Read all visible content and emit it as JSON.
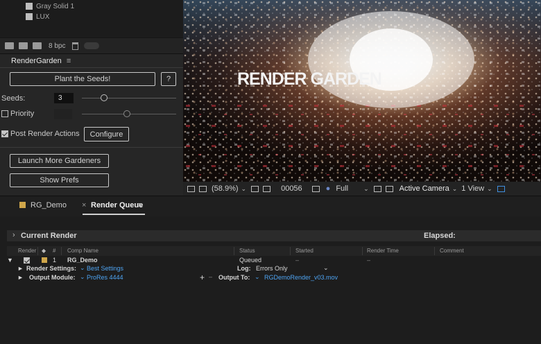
{
  "project": {
    "items": [
      "Gray Solid 1",
      "LUX"
    ],
    "bpc": "8 bpc"
  },
  "render_garden": {
    "title": "RenderGarden",
    "menu_glyph": "≡",
    "plant_button": "Plant the Seeds!",
    "help_button": "?",
    "seeds_label": "Seeds:",
    "seeds_value": "3",
    "priority_label": "Priority",
    "priority_checked": false,
    "post_render_label": "Post Render Actions",
    "post_render_checked": true,
    "configure_button": "Configure",
    "launch_button": "Launch More Gardeners",
    "prefs_button": "Show Prefs"
  },
  "viewer": {
    "overlay_text": "RENDER GARDEN",
    "zoom": "(58.9%)",
    "timecode": "00056",
    "resolution": "Full",
    "camera": "Active Camera",
    "views": "1 View"
  },
  "tabs": {
    "comp_tab": "RG_Demo",
    "close_glyph": "×",
    "active_tab": "Render Queue",
    "menu_glyph": "≡",
    "comp_color": "#cfa64a"
  },
  "render_queue": {
    "current_render_label": "Current Render",
    "elapsed_label": "Elapsed:",
    "columns": {
      "render": "Render",
      "num": "#",
      "comp_name": "Comp Name",
      "status": "Status",
      "started": "Started",
      "render_time": "Render Time",
      "comment": "Comment"
    },
    "item": {
      "number": "1",
      "comp_name": "RG_Demo",
      "status": "Queued",
      "started": "–",
      "render_time": "–",
      "render_settings_label": "Render Settings:",
      "render_settings_value": "Best Settings",
      "log_label": "Log:",
      "log_value": "Errors Only",
      "output_module_label": "Output Module:",
      "output_module_value": "ProRes 4444",
      "output_to_label": "Output To:",
      "output_to_value": "RGDemoRender_v03.mov"
    },
    "accent_color": "#4ea4f2"
  }
}
